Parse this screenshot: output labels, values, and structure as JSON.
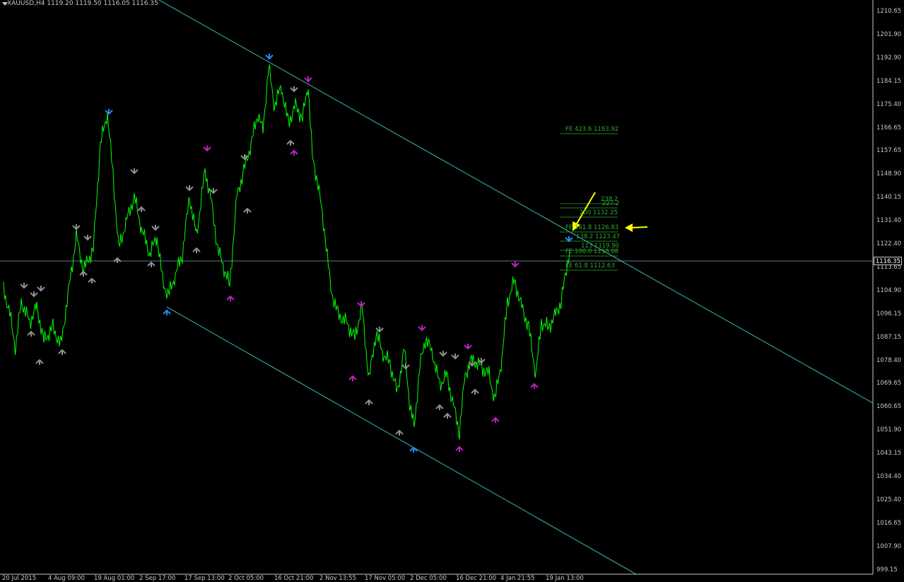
{
  "header": {
    "text": "XAUUSD,H4  1119.20 1119.50 1116.05 1116.35"
  },
  "current_price": "1116.35",
  "price_axis": [
    "1210.65",
    "1201.90",
    "1192.90",
    "1184.15",
    "1175.40",
    "1166.65",
    "1157.65",
    "1148.90",
    "1140.15",
    "1131.40",
    "1122.40",
    "1113.65",
    "1104.90",
    "1096.15",
    "1087.15",
    "1078.40",
    "1069.65",
    "1060.65",
    "1051.90",
    "1043.15",
    "1034.40",
    "1025.40",
    "1016.65",
    "1007.90",
    "999.15"
  ],
  "time_axis": [
    "20 Jul 2015",
    "4 Aug 09:00",
    "19 Aug 01:00",
    "2 Sep 17:00",
    "17 Sep 13:00",
    "2 Oct 05:00",
    "16 Oct 21:00",
    "2 Nov 13:55",
    "17 Nov 05:00",
    "2 Dec 05:00",
    "16 Dec 21:00",
    "4 Jan 21:55",
    "19 Jan 13:00"
  ],
  "fib_labels": [
    "FE 423.6 1163.92",
    "238.2",
    "227.2",
    "200 1132.25",
    "FE 161.8 1126.83",
    "138.2 1123.47",
    "113 1119.90",
    "FE 100.0 1118.08",
    "FE 61.8 1112.63"
  ],
  "colors": {
    "background": "#000000",
    "price_line": "#00ff00",
    "channel": "#40c8c8",
    "arrow_blue": "#1e90ff",
    "arrow_magenta": "#c020c0",
    "arrow_gray": "#909090",
    "annotation": "#ffff00",
    "fib": "#2fa82f",
    "axis_text": "#c8c8c8"
  },
  "chart_data": {
    "type": "line",
    "title": "XAUUSD,H4",
    "ylim": [
      995,
      1215
    ],
    "x": [
      "20 Jul 2015",
      "4 Aug 09:00",
      "19 Aug 01:00",
      "2 Sep 17:00",
      "17 Sep 13:00",
      "2 Oct 05:00",
      "16 Oct 21:00",
      "2 Nov 13:55",
      "17 Nov 05:00",
      "2 Dec 05:00",
      "16 Dec 21:00",
      "4 Jan 21:55",
      "19 Jan 13:00"
    ],
    "series": [
      {
        "values": [
          1096,
          1083,
          1118,
          1172,
          1102,
          1140,
          1190,
          1170,
          1105,
          1083,
          1066,
          1112,
          1120
        ]
      }
    ],
    "grid": false
  }
}
